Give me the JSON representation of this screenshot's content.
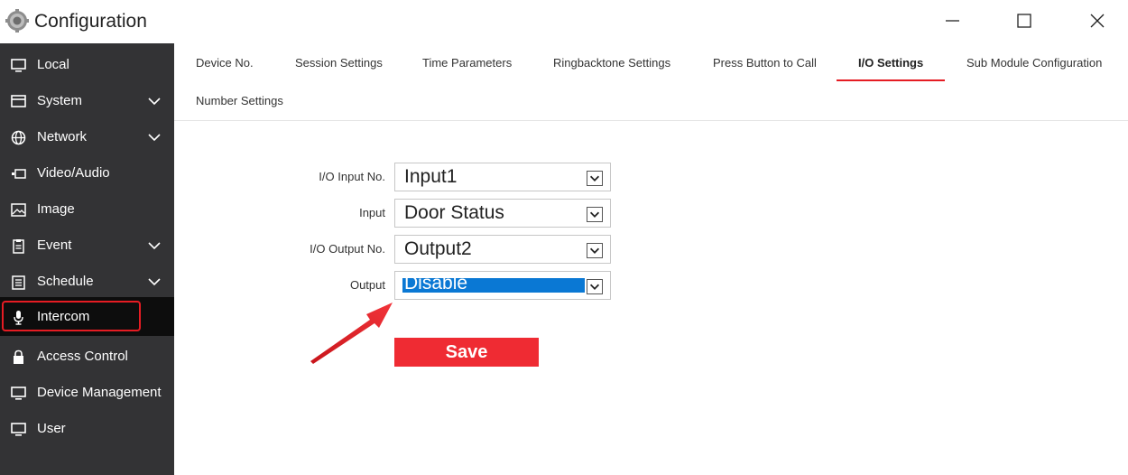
{
  "window": {
    "title": "Configuration"
  },
  "sidebar": {
    "items": [
      {
        "label": "Local",
        "icon": "monitor-icon",
        "expandable": false
      },
      {
        "label": "System",
        "icon": "system-icon",
        "expandable": true
      },
      {
        "label": "Network",
        "icon": "globe-icon",
        "expandable": true
      },
      {
        "label": "Video/Audio",
        "icon": "video-icon",
        "expandable": false
      },
      {
        "label": "Image",
        "icon": "image-icon",
        "expandable": false
      },
      {
        "label": "Event",
        "icon": "clipboard-icon",
        "expandable": true
      },
      {
        "label": "Schedule",
        "icon": "schedule-icon",
        "expandable": true
      },
      {
        "label": "Intercom",
        "icon": "microphone-icon",
        "expandable": false,
        "active": true
      },
      {
        "label": "Access Control",
        "icon": "lock-icon",
        "expandable": false
      },
      {
        "label": "Device Management",
        "icon": "monitor-icon",
        "expandable": false
      },
      {
        "label": "User",
        "icon": "monitor-icon",
        "expandable": false
      }
    ]
  },
  "tabs": [
    {
      "label": "Device No."
    },
    {
      "label": "Session Settings"
    },
    {
      "label": "Time Parameters"
    },
    {
      "label": "Ringbacktone Settings"
    },
    {
      "label": "Press Button to Call"
    },
    {
      "label": "I/O Settings",
      "active": true
    },
    {
      "label": "Sub Module Configuration"
    },
    {
      "label": "Number Settings"
    }
  ],
  "form": {
    "io_input_no": {
      "label": "I/O Input No.",
      "value": "Input1"
    },
    "input": {
      "label": "Input",
      "value": "Door Status"
    },
    "io_output_no": {
      "label": "I/O Output No.",
      "value": "Output2"
    },
    "output": {
      "label": "Output",
      "value": "Disable"
    },
    "save_label": "Save"
  },
  "colors": {
    "accent": "#e51c23",
    "sidebar_bg": "#333335",
    "selection": "#0a78d4",
    "save_button": "#ef2b33"
  }
}
